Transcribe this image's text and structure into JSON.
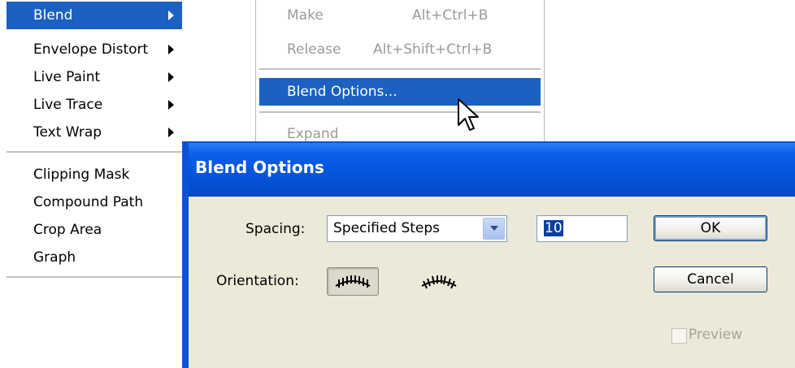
{
  "left_menu": {
    "items": [
      {
        "label": "Blend",
        "has_submenu": true,
        "selected": true
      },
      {
        "label": "Envelope Distort",
        "has_submenu": true
      },
      {
        "label": "Live Paint",
        "has_submenu": true
      },
      {
        "label": "Live Trace",
        "has_submenu": true
      },
      {
        "label": "Text Wrap",
        "has_submenu": true
      },
      {
        "label": "Clipping Mask"
      },
      {
        "label": "Compound Path"
      },
      {
        "label": "Crop Area"
      },
      {
        "label": "Graph"
      }
    ]
  },
  "submenu": {
    "items": [
      {
        "label": "Make",
        "shortcut": "Alt+Ctrl+B",
        "enabled": false
      },
      {
        "label": "Release",
        "shortcut": "Alt+Shift+Ctrl+B",
        "enabled": false
      },
      {
        "label": "Blend Options...",
        "shortcut": "",
        "selected": true
      },
      {
        "label": "Expand",
        "shortcut": "",
        "enabled": false
      }
    ]
  },
  "dialog": {
    "title": "Blend Options",
    "spacing_label": "Spacing:",
    "spacing_value": "Specified Steps",
    "steps_value": "10",
    "orientation_label": "Orientation:",
    "orientation_options": [
      "align-to-page-icon",
      "align-to-path-icon"
    ],
    "ok_label": "OK",
    "cancel_label": "Cancel",
    "preview_label": "Preview",
    "preview_checked": false
  },
  "colors": {
    "selection": "#1a61c2",
    "title_bar": "#0a54d3",
    "dialog_bg": "#ece9d8",
    "disabled_text": "#9a9a9a"
  }
}
